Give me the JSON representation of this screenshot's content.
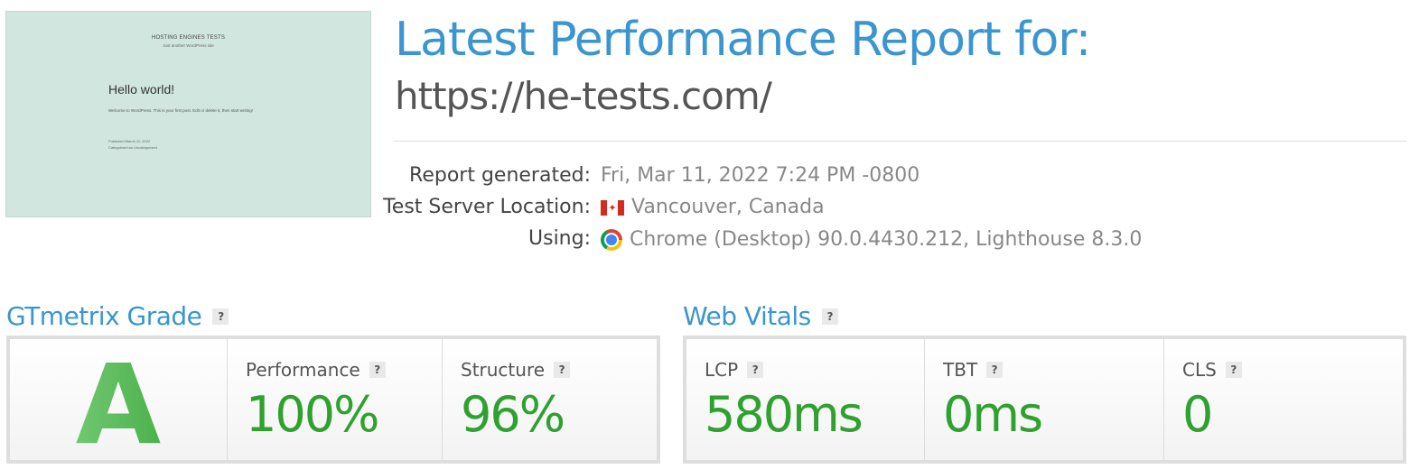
{
  "thumbnail": {
    "site_title": "HOSTING ENGINES TESTS",
    "tagline": "Just another WordPress site",
    "post_title": "Hello world!",
    "post_body": "Welcome to WordPress. This is your first post. Edit or delete it, then start writing!",
    "published": "Published March 11, 2022",
    "categorized": "Categorized as Uncategorized"
  },
  "header": {
    "title": "Latest Performance Report for:",
    "url": "https://he-tests.com/"
  },
  "meta": {
    "generated_label": "Report generated:",
    "generated_value": "Fri, Mar 11, 2022 7:24 PM -0800",
    "location_label": "Test Server Location:",
    "location_value": "Vancouver, Canada",
    "using_label": "Using:",
    "using_value": "Chrome (Desktop) 90.0.4430.212, Lighthouse 8.3.0",
    "flag_icon": "canada-flag-icon",
    "browser_icon": "chrome-icon"
  },
  "grade": {
    "section_title": "GTmetrix Grade",
    "help": "?",
    "letter": "A",
    "performance_label": "Performance",
    "performance_value": "100%",
    "structure_label": "Structure",
    "structure_value": "96%"
  },
  "vitals": {
    "section_title": "Web Vitals",
    "help": "?",
    "lcp_label": "LCP",
    "lcp_value": "580ms",
    "tbt_label": "TBT",
    "tbt_value": "0ms",
    "cls_label": "CLS",
    "cls_value": "0"
  },
  "colors": {
    "accent_blue": "#3b95d0",
    "good_green": "#2ea12e"
  }
}
